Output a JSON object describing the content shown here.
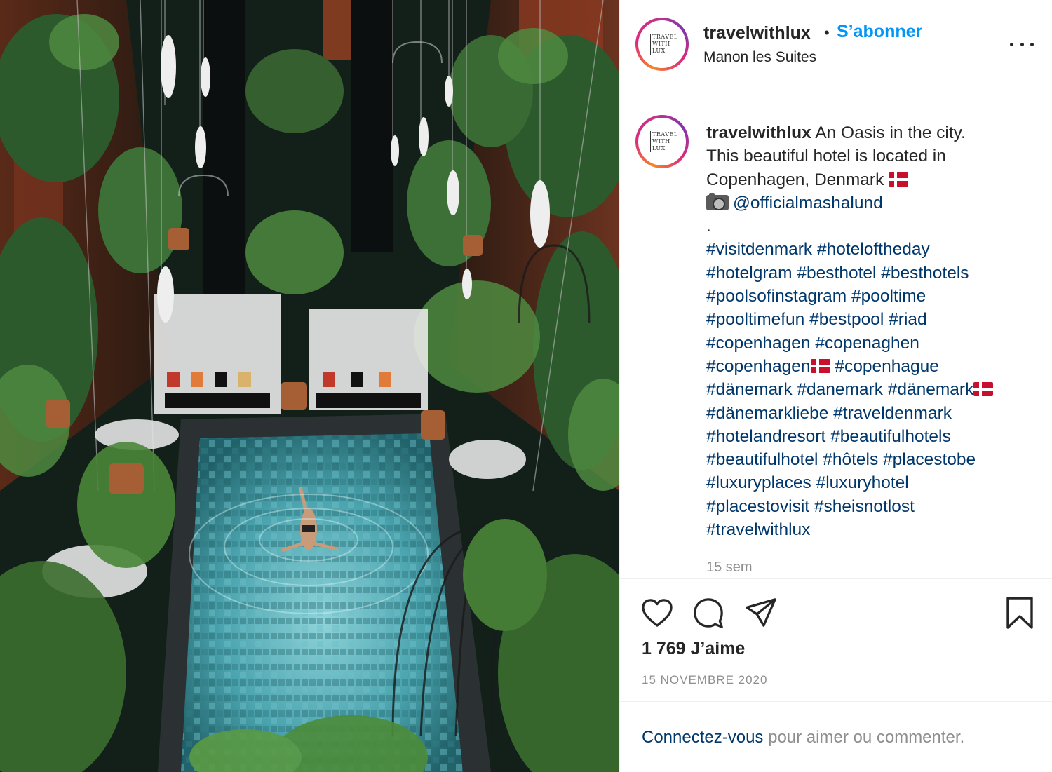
{
  "post": {
    "username": "travelwithlux",
    "separator": "•",
    "follow_label": "S’abonner",
    "location": "Manon les Suites",
    "avatar_logo_text": "TRAVEL WITH LUX",
    "caption": {
      "username": "travelwithlux",
      "line1": "An Oasis in the city.",
      "line2": "This beautiful hotel is located in",
      "line3": "Copenhagen, Denmark",
      "mention": "@officialmashalund",
      "dot": ".",
      "hashtags": [
        "#visitdenmark #hoteloftheday",
        "#hotelgram #besthotel #besthotels",
        "#poolsofinstagram #pooltime",
        "#pooltimefun #bestpool #riad",
        "#copenhagen #copenaghen"
      ],
      "ht_copenhagen": "#copenhagen",
      "ht_copenhague": "#copenhague",
      "ht_danemark_line": "#dänemark #danemark #dänemark",
      "hashtags_after": [
        "#dänemarkliebe #traveldenmark",
        "#hotelandresort #beautifulhotels",
        "#beautifulhotel #hôtels #placestobe",
        "#luxuryplaces #luxuryhotel",
        "#placestovisit #sheisnotlost",
        "#travelwithlux"
      ]
    },
    "time_ago": "15 sem",
    "likes": "1 769 J’aime",
    "date": "15 NOVEMBRE 2020",
    "login_link": "Connectez-vous",
    "login_rest": " pour aimer ou commenter."
  },
  "icons": {
    "like": "heart-icon",
    "comment": "comment-icon",
    "share": "paper-plane-icon",
    "save": "bookmark-icon",
    "more": "more-options-icon",
    "camera": "camera-icon",
    "flag": "denmark-flag-icon"
  },
  "colors": {
    "link_blue": "#0095f6",
    "hashtag_blue": "#00376b",
    "text": "#262626",
    "muted": "#8e8e8e",
    "border": "#efefef"
  }
}
